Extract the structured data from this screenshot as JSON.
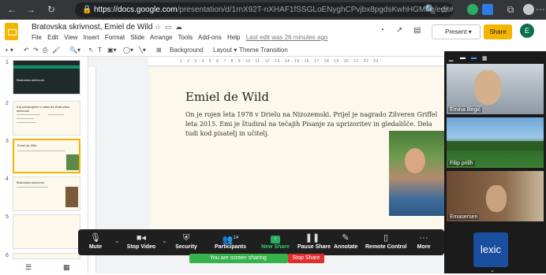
{
  "browser": {
    "url_scheme": "https://",
    "url_host": "docs.google.com",
    "url_path": "/presentation/d/1rnX92T-nXHAF1fSSGLoENyghCPvjbx8pgdsKwhHGMeg/edit#slid..."
  },
  "doc": {
    "title": "Bratovska skrivnost, Emiel de Wild",
    "menu": [
      "File",
      "Edit",
      "View",
      "Insert",
      "Format",
      "Slide",
      "Arrange",
      "Tools",
      "Add-ons",
      "Help"
    ],
    "last_edit": "Last edit was 26 minutes ago",
    "present_label": "Present",
    "share_label": "Share",
    "avatar_letter": "E"
  },
  "toolbar": {
    "background": "Background",
    "layout": "Layout",
    "theme": "Theme",
    "transition": "Transition"
  },
  "ruler": "1 · 2 · 3 · 4 · 5 · 6 · 7 · 8 · 9 · 10 · 11 · 12 · 13 · 14 · 15 · 16 · 17 · 18 · 19 · 20 · 21 · 22 · 23 ·",
  "filmstrip": {
    "slides": [
      {
        "num": "1",
        "title": "Bratovska skrivnost"
      },
      {
        "num": "2",
        "title": "Kaj pričakujemo v odlomek Bratovska skrivnost"
      },
      {
        "num": "3",
        "title": "Emiel de Wild"
      },
      {
        "num": "4",
        "title": "Bratovska skrivnost"
      },
      {
        "num": "5",
        "title": ""
      },
      {
        "num": "6",
        "title": ""
      }
    ]
  },
  "slide": {
    "title": "Emiel de Wild",
    "body": "On je rojen leta 1978 v Drielu na Nizozemski. Prijel je nagrado Zilveren Griffel leta 2015. Emi je študiral na tečajih Pisanje za uprizoritev in gledališče. Dela tudi kod pisatelj in učitelj.",
    "partial_text": "Emiel in a ... poslopitu. Nedelja ..."
  },
  "zoom_bar": {
    "mute": "Mute",
    "stop_video": "Stop Video",
    "security": "Security",
    "participants": "Participants",
    "participants_count": "14",
    "new_share": "New Share",
    "pause_share": "Pause Share",
    "annotate": "Annotate",
    "remote_control": "Remote Control",
    "more": "More",
    "sharing_banner": "You are screen sharing",
    "stop_share": "Stop Share"
  },
  "zoom_panel": {
    "participants": [
      {
        "name": "Emina Begić"
      },
      {
        "name": "Filip prilih"
      },
      {
        "name": "Emasersen"
      }
    ],
    "logo_text": "lexic"
  },
  "colors": {
    "accent": "#f4b400",
    "share_green": "#36b24a",
    "stop_red": "#e02f2f"
  }
}
